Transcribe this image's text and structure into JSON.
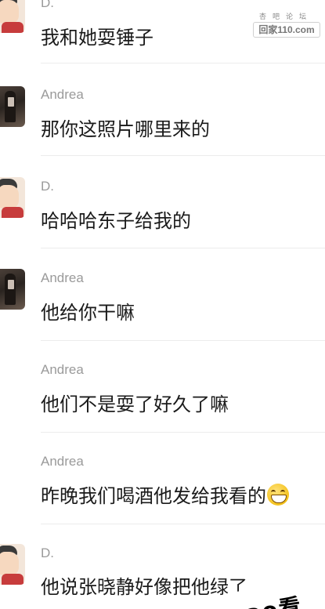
{
  "watermark": {
    "top": "杏吧论坛",
    "main": "回家110.com"
  },
  "messages": [
    {
      "sender": "D.",
      "avatar": "cartoon-avatar",
      "text": "我和她耍锤子"
    },
    {
      "sender": "Andrea",
      "avatar": "photo-avatar",
      "text": "那你这照片哪里来的"
    },
    {
      "sender": "D.",
      "avatar": "cartoon-avatar",
      "text": "哈哈哈东子给我的"
    },
    {
      "sender": "Andrea",
      "avatar": "photo-avatar",
      "text": "他给你干嘛"
    },
    {
      "sender": "Andrea",
      "avatar": "none",
      "text": "他们不是耍了好久了嘛"
    },
    {
      "sender": "Andrea",
      "avatar": "none",
      "text": "昨晚我们喝酒他发给我看的",
      "emoji": "grinning-face-emoji"
    },
    {
      "sender": "D.",
      "avatar": "cartoon-avatar",
      "text": "他说张晓静好像把他绿了"
    }
  ],
  "corner_overlay": {
    "text": "ao看"
  }
}
